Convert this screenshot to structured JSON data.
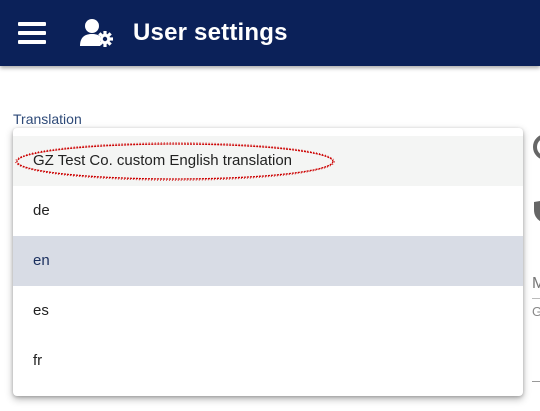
{
  "header": {
    "title": "User settings",
    "background_color": "#0b2159",
    "menu_icon": "hamburger-menu-icon",
    "user_icon": "user-gear-icon"
  },
  "field": {
    "label": "Translation"
  },
  "dropdown": {
    "options": [
      {
        "label": "GZ Test Co. custom English translation",
        "state": "hover"
      },
      {
        "label": "de",
        "state": "normal"
      },
      {
        "label": "en",
        "state": "selected"
      },
      {
        "label": "es",
        "state": "normal"
      },
      {
        "label": "fr",
        "state": "normal"
      }
    ],
    "selected_color": "#d8dce5",
    "hover_color": "#f4f5f4"
  },
  "background": {
    "partial_text_1": "M",
    "partial_text_2": "G"
  },
  "annotation": {
    "shape": "ellipse",
    "color": "#cc0000"
  }
}
